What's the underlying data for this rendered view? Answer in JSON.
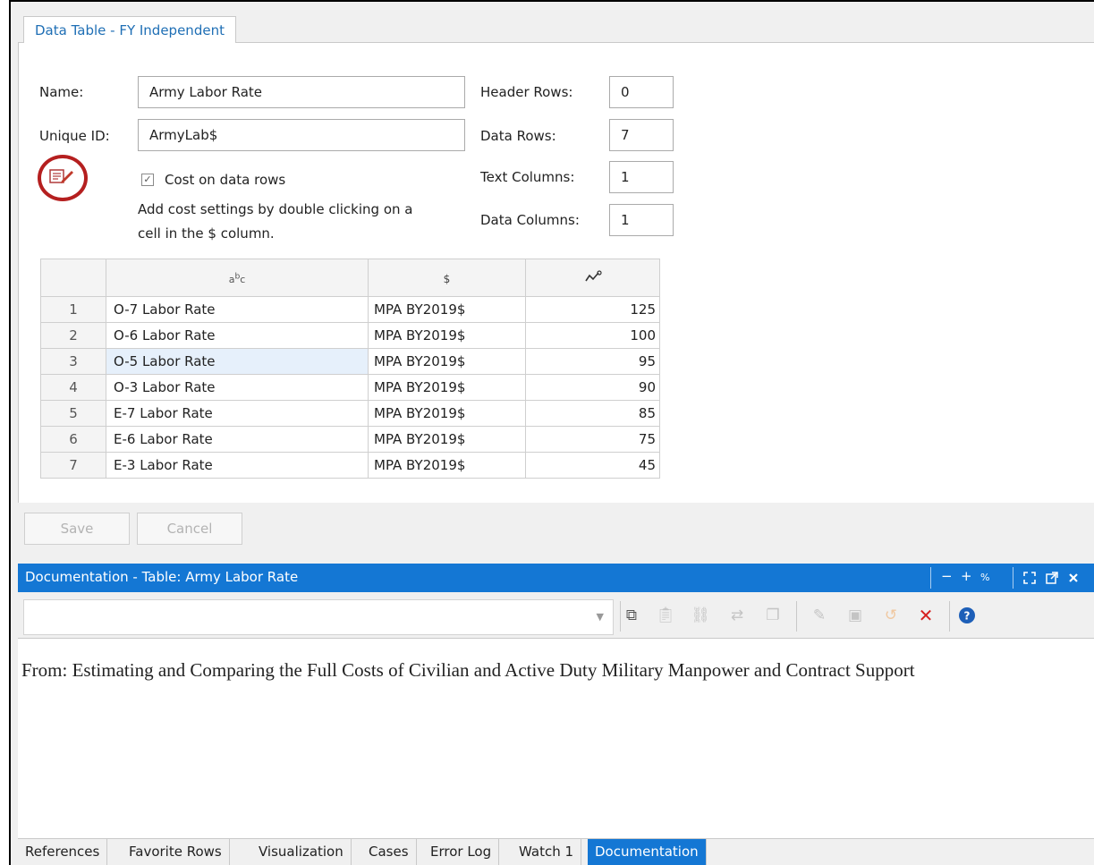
{
  "editor_tab": {
    "label": "Data Table - FY Independent"
  },
  "form": {
    "name_label": "Name:",
    "name_value": "Army Labor Rate",
    "uid_label": "Unique ID:",
    "uid_value": "ArmyLab$",
    "header_rows_label": "Header Rows:",
    "header_rows_value": "0",
    "data_rows_label": "Data Rows:",
    "data_rows_value": "7",
    "text_columns_label": "Text Columns:",
    "text_columns_value": "1",
    "data_columns_label": "Data Columns:",
    "data_columns_value": "1",
    "cost_checkbox_label": "Cost on data rows",
    "cost_checked": true,
    "hint_line1": "Add cost settings by double clicking on a",
    "hint_line2": "cell in the $ column."
  },
  "grid": {
    "headers": [
      "",
      "abc",
      "$",
      "↗"
    ],
    "rows": [
      {
        "n": "1",
        "name": "O-7 Labor Rate",
        "unit": "MPA BY2019$",
        "value": "125"
      },
      {
        "n": "2",
        "name": "O-6 Labor Rate",
        "unit": "MPA BY2019$",
        "value": "100"
      },
      {
        "n": "3",
        "name": "O-5 Labor Rate",
        "unit": "MPA BY2019$",
        "value": "95"
      },
      {
        "n": "4",
        "name": "O-3 Labor Rate",
        "unit": "MPA BY2019$",
        "value": "90"
      },
      {
        "n": "5",
        "name": "E-7 Labor Rate",
        "unit": "MPA BY2019$",
        "value": "85"
      },
      {
        "n": "6",
        "name": "E-6 Labor Rate",
        "unit": "MPA BY2019$",
        "value": "75"
      },
      {
        "n": "7",
        "name": "E-3 Labor Rate",
        "unit": "MPA BY2019$",
        "value": "45"
      }
    ]
  },
  "buttons": {
    "save": "Save",
    "cancel": "Cancel"
  },
  "doc_panel": {
    "title": "Documentation  - Table: Army Labor Rate",
    "controls": {
      "minus": "−",
      "plus": "+",
      "percent": "%"
    },
    "text": "From: Estimating and Comparing the Full Costs of Civilian and Active Duty Military Manpower and Contract Support"
  },
  "bottom_tabs": [
    "References",
    "Favorite Rows",
    "Visualization",
    "Cases",
    "Error Log",
    "Watch 1",
    "Documentation"
  ],
  "colors": {
    "accent": "#1477d4",
    "highlight_circle": "#b51f1f",
    "delete_red": "#d6201f",
    "help_blue": "#1d5fb8"
  }
}
